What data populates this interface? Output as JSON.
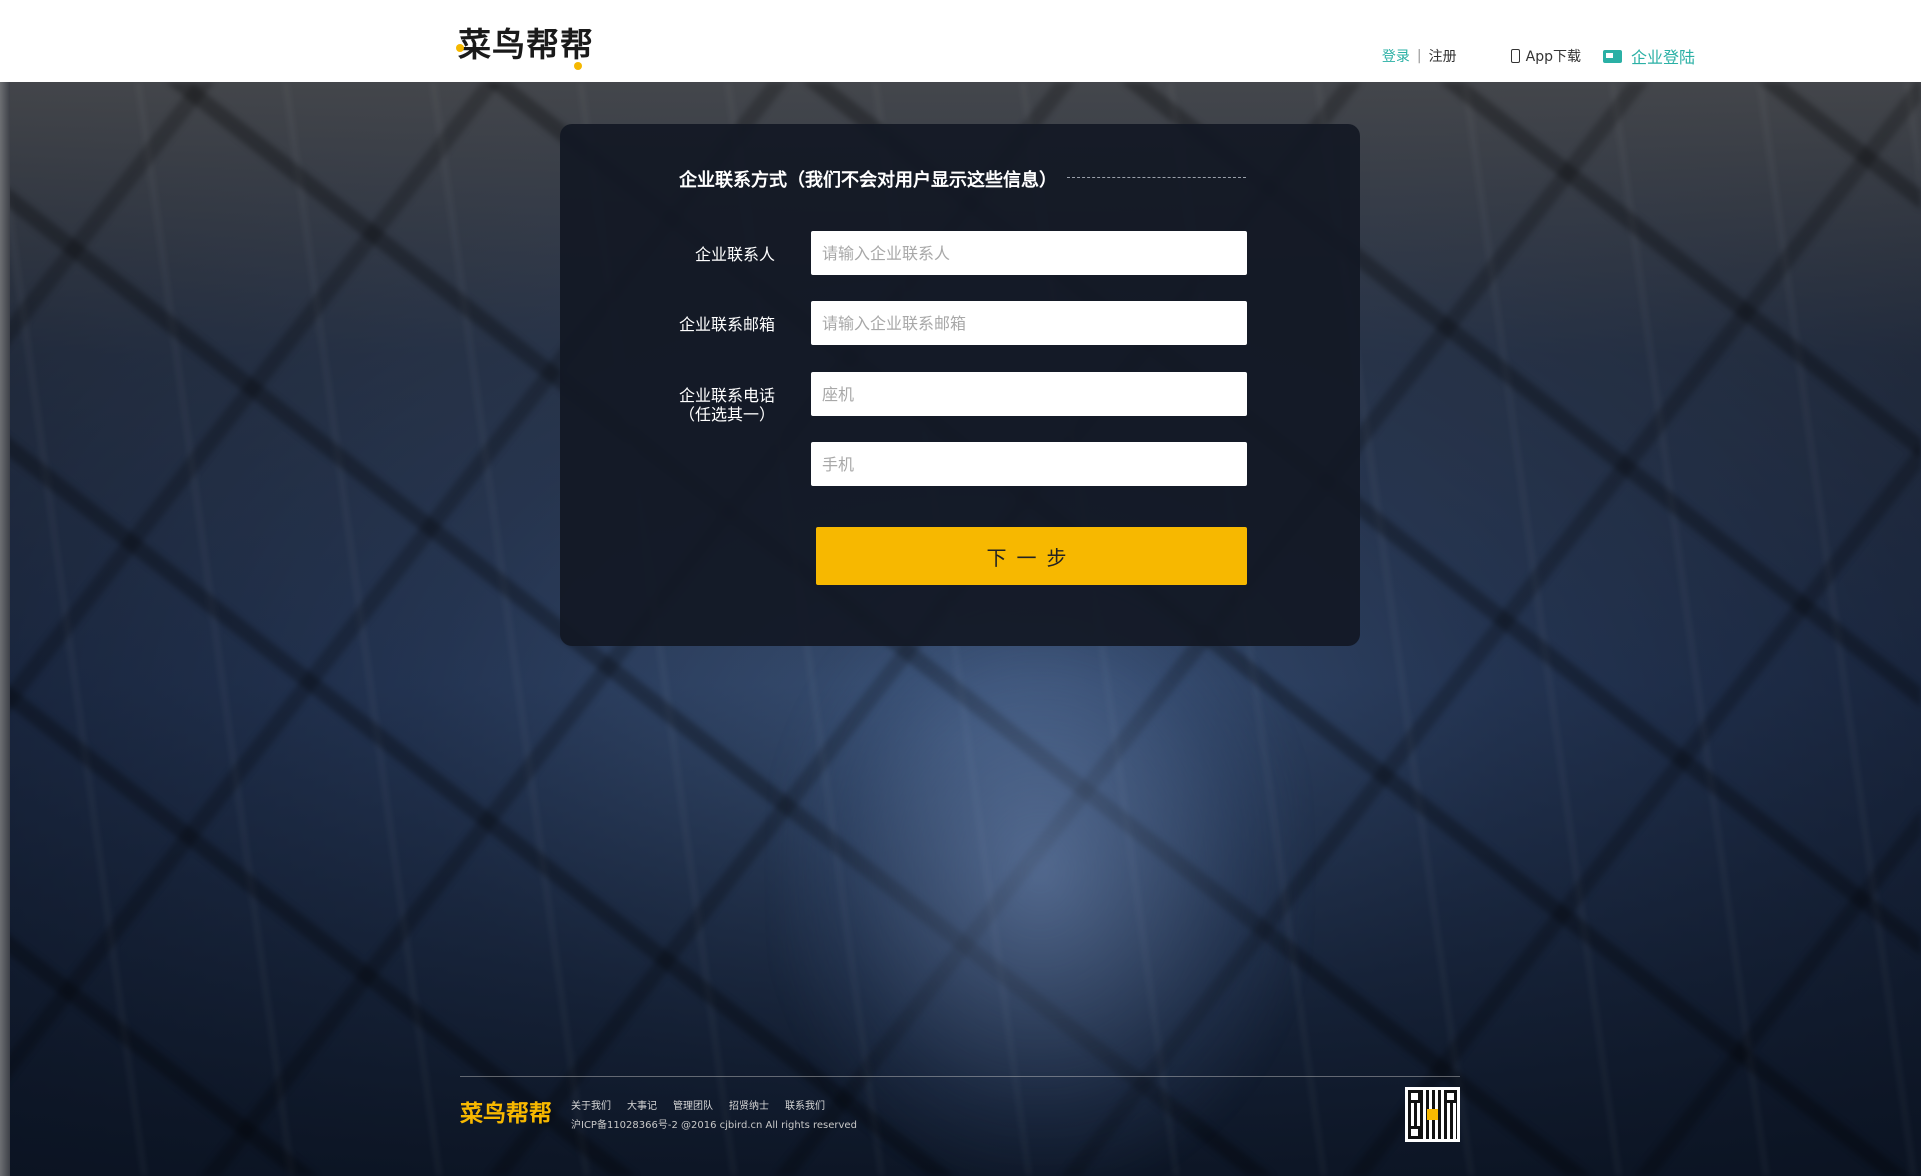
{
  "header": {
    "logo_text": "菜鸟帮帮",
    "login_label": "登录",
    "separator": "|",
    "register_label": "注册",
    "app_download_label": "App下载",
    "company_login_label": "企业登陆"
  },
  "form": {
    "title": "企业联系方式（我们不会对用户显示这些信息）",
    "contact_person": {
      "label": "企业联系人",
      "placeholder": "请输入企业联系人",
      "value": ""
    },
    "contact_email": {
      "label": "企业联系邮箱",
      "placeholder": "请输入企业联系邮箱",
      "value": ""
    },
    "contact_phone": {
      "label_line1": "企业联系电话",
      "label_line2": "（任选其一）",
      "landline_placeholder": "座机",
      "mobile_placeholder": "手机"
    },
    "next_button": "下一步"
  },
  "footer": {
    "logo_text": "菜鸟帮帮",
    "links": [
      "关于我们",
      "大事记",
      "管理团队",
      "招贤纳士",
      "联系我们"
    ],
    "copyright": "沪ICP备11028366号-2 @2016 cjbird.cn All rights reserved"
  },
  "colors": {
    "accent_teal": "#2ab0a5",
    "button_yellow": "#f7b800",
    "panel_dark": "#121824"
  },
  "icons": {
    "app_download": "phone-icon",
    "company_login": "laptop-icon",
    "qr": "qr-code-icon"
  }
}
